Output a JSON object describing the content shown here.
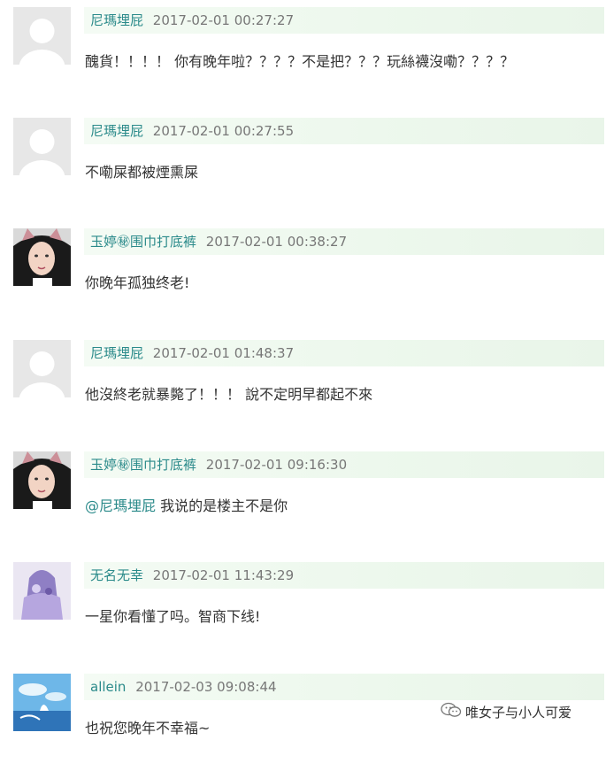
{
  "comments": [
    {
      "avatar": "default-avatar",
      "username": "尼瑪埋屁",
      "time": "2017-02-01 00:27:27",
      "text": "醜貨！！！！ 你有晚年啦？？？？不是把？？？玩絲襪沒嘞？？？？"
    },
    {
      "avatar": "default-avatar",
      "username": "尼瑪埋屁",
      "time": "2017-02-01 00:27:55",
      "text": "不嘞屎都被煙熏屎"
    },
    {
      "avatar": "cat-ear-girl-avatar",
      "username": "玉婷㊙围巾打底裤",
      "time": "2017-02-01 00:38:27",
      "text": "你晚年孤独终老!"
    },
    {
      "avatar": "default-avatar",
      "username": "尼瑪埋屁",
      "time": "2017-02-01 01:48:37",
      "text": "他沒終老就暴斃了！！！ 說不定明早都起不來"
    },
    {
      "avatar": "cat-ear-girl-avatar",
      "username": "玉婷㊙围巾打底裤",
      "time": "2017-02-01 09:16:30",
      "mention": "@尼瑪埋屁",
      "text": "我说的是楼主不是你"
    },
    {
      "avatar": "purple-photo-avatar",
      "username": "无名无幸",
      "time": "2017-02-01 11:43:29",
      "text": "一星你看懂了吗。智商下线!"
    },
    {
      "avatar": "sky-scenery-avatar",
      "username": "allein",
      "time": "2017-02-03 09:08:44",
      "text": "也祝您晚年不幸福~"
    }
  ],
  "watermark": {
    "icon": "wechat-icon",
    "text": "唯女子与小人可爱"
  },
  "colors": {
    "username": "#2a8a8a",
    "timestamp": "#777777",
    "header_background": "#edf8ed",
    "body_text": "#333333"
  }
}
